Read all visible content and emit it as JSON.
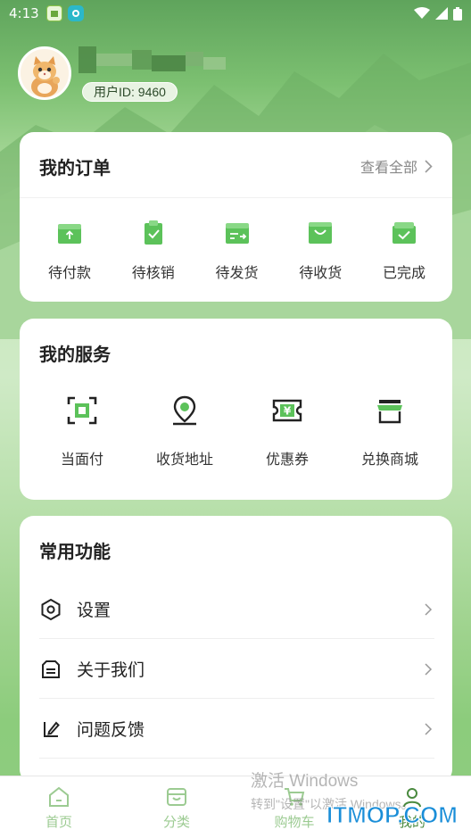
{
  "status_bar": {
    "time": "4:13"
  },
  "profile": {
    "user_id": "用户ID: 9460"
  },
  "orders": {
    "title": "我的订单",
    "view_all": "查看全部",
    "items": [
      {
        "label": "待付款",
        "icon": "wallet-upload-icon"
      },
      {
        "label": "待核销",
        "icon": "clipboard-check-icon"
      },
      {
        "label": "待发货",
        "icon": "box-send-icon"
      },
      {
        "label": "待收货",
        "icon": "shopping-bag-icon"
      },
      {
        "label": "已完成",
        "icon": "box-check-icon"
      }
    ]
  },
  "services": {
    "title": "我的服务",
    "items": [
      {
        "label": "当面付",
        "icon": "scan-pay-icon"
      },
      {
        "label": "收货地址",
        "icon": "location-pin-icon"
      },
      {
        "label": "优惠券",
        "icon": "coupon-icon"
      },
      {
        "label": "兑换商城",
        "icon": "store-icon"
      }
    ]
  },
  "common": {
    "title": "常用功能",
    "items": [
      {
        "label": "设置",
        "icon": "settings-icon"
      },
      {
        "label": "关于我们",
        "icon": "about-icon"
      },
      {
        "label": "问题反馈",
        "icon": "feedback-icon"
      }
    ]
  },
  "tabs": [
    {
      "label": "首页",
      "icon": "home-icon"
    },
    {
      "label": "分类",
      "icon": "category-icon"
    },
    {
      "label": "购物车",
      "icon": "cart-icon"
    },
    {
      "label": "我的",
      "icon": "user-icon",
      "active": true
    }
  ],
  "watermark": {
    "line1": "激活 Windows",
    "line2": "转到\"设置\"以激活 Windows。",
    "site": "ITMOP.COM"
  },
  "colors": {
    "accent": "#5cc25a",
    "accent_dark": "#3b7a33",
    "tab_inactive": "#9ccb92"
  }
}
